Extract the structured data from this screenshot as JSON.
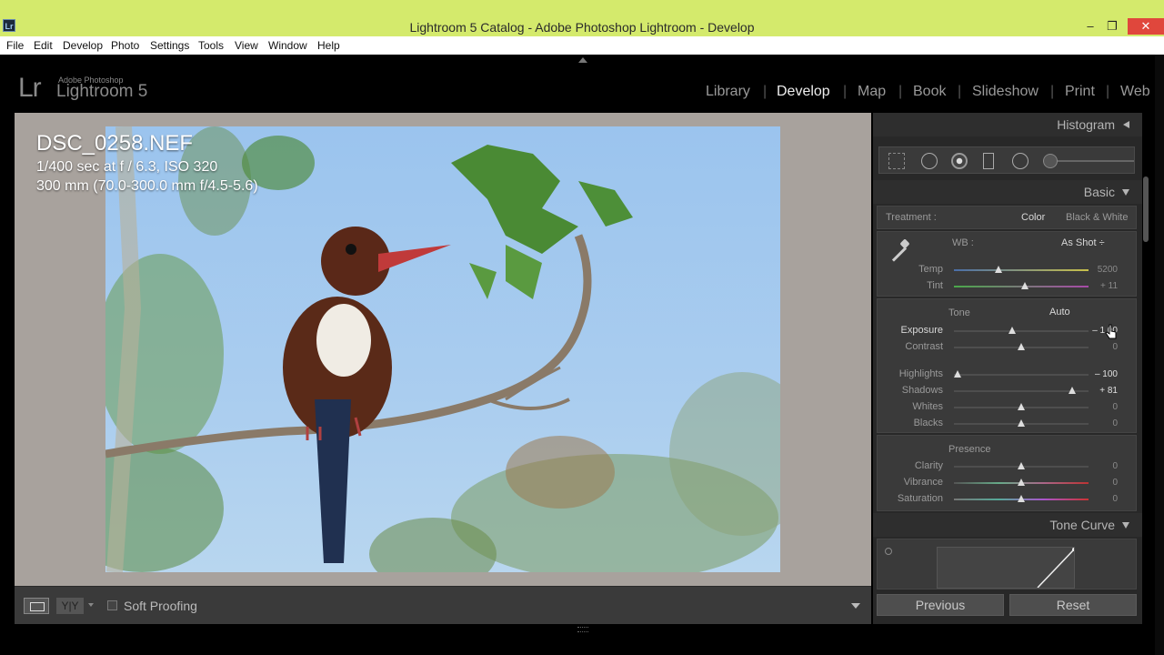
{
  "window": {
    "app_icon": "Lr",
    "title": "Lightroom 5 Catalog - Adobe Photoshop Lightroom - Develop",
    "minimize": "–",
    "restore": "❐",
    "close": "✕"
  },
  "menu": [
    "File",
    "Edit",
    "Develop",
    "Photo",
    "Settings",
    "Tools",
    "View",
    "Window",
    "Help"
  ],
  "identity": {
    "logo": "Lr",
    "vendor": "Adobe Photoshop",
    "product": "Lightroom 5"
  },
  "modules": {
    "items": [
      "Library",
      "Develop",
      "Map",
      "Book",
      "Slideshow",
      "Print",
      "Web"
    ],
    "separator": "|",
    "active": "Develop"
  },
  "photo_info": {
    "filename": "DSC_0258.NEF",
    "exposure": "1/400 sec at f / 6.3, ISO 320",
    "lens": "300 mm (70.0-300.0 mm f/4.5-5.6)"
  },
  "toolbar": {
    "yy_label": "Y|Y",
    "soft_proofing": "Soft Proofing"
  },
  "panel": {
    "histogram": "Histogram",
    "basic": "Basic",
    "treatment_label": "Treatment :",
    "treatment_color": "Color",
    "treatment_bw": "Black & White",
    "wb_label": "WB :",
    "wb_value": "As Shot ÷",
    "temp_label": "Temp",
    "temp_value": "5200",
    "temp_level": 0.33,
    "tint_label": "Tint",
    "tint_value": "+ 11",
    "tint_level": 0.53,
    "tone_label": "Tone",
    "auto_label": "Auto",
    "exposure_label": "Exposure",
    "exposure_value": "– 1.00",
    "exposure_level": 0.43,
    "contrast_label": "Contrast",
    "contrast_value": "0",
    "contrast_level": 0.5,
    "highlights_label": "Highlights",
    "highlights_value": "– 100",
    "highlights_level": 0.03,
    "shadows_label": "Shadows",
    "shadows_value": "+ 81",
    "shadows_level": 0.88,
    "whites_label": "Whites",
    "whites_value": "0",
    "whites_level": 0.5,
    "blacks_label": "Blacks",
    "blacks_value": "0",
    "blacks_level": 0.5,
    "presence_label": "Presence",
    "clarity_label": "Clarity",
    "clarity_value": "0",
    "clarity_level": 0.5,
    "vibrance_label": "Vibrance",
    "vibrance_value": "0",
    "vibrance_level": 0.5,
    "saturation_label": "Saturation",
    "saturation_value": "0",
    "saturation_level": 0.5,
    "tone_curve": "Tone Curve",
    "previous": "Previous",
    "reset": "Reset"
  }
}
